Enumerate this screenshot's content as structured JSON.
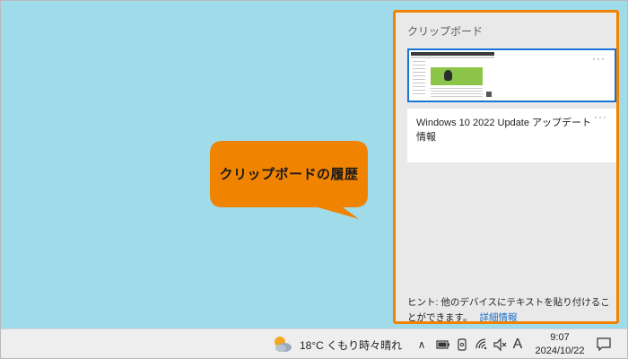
{
  "callout": {
    "text": "クリップボードの履歴"
  },
  "clipboard": {
    "title": "クリップボード",
    "items": [
      {
        "type": "image",
        "more_label": "···"
      },
      {
        "type": "text",
        "text": "Windows 10 2022 Update アップデート情報",
        "more_label": "···"
      }
    ],
    "hint": "ヒント: 他のデバイスにテキストを貼り付けることができます。",
    "hint_link": "詳細情報"
  },
  "taskbar": {
    "weather": "18°C  くもり時々晴れ",
    "tray": {
      "chevron": "∧",
      "ime": "A"
    },
    "time": "9:07",
    "date": "2024/10/22"
  },
  "colors": {
    "desktop": "#9fdbe9",
    "callout": "#f08300",
    "panel_border": "#f08300",
    "selection": "#1a73d6",
    "link": "#1a6fc9"
  }
}
